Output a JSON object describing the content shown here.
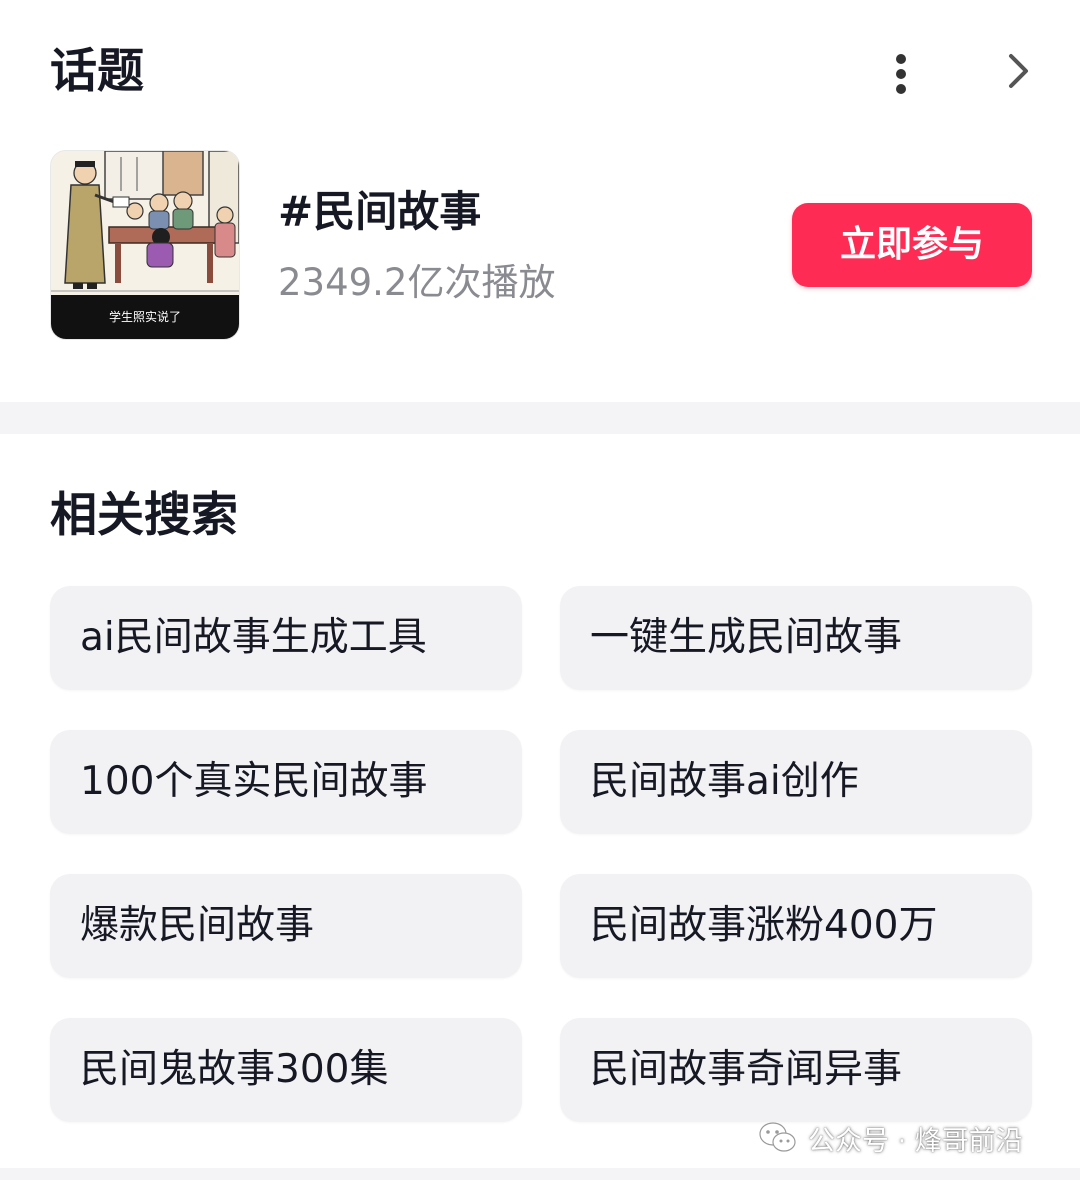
{
  "topic_section": {
    "title": "话题",
    "more_icon": "more-vertical-icon",
    "chevron_icon": "chevron-right-icon"
  },
  "topic": {
    "thumbnail_caption": "学生照实说了",
    "name": "#民间故事",
    "plays": "2349.2亿次播放",
    "join_label": "立即参与",
    "join_color": "#fe2c55"
  },
  "related": {
    "title": "相关搜索",
    "items": [
      {
        "label": "ai民间故事生成工具"
      },
      {
        "label": "一键生成民间故事"
      },
      {
        "label": "100个真实民间故事"
      },
      {
        "label": "民间故事ai创作"
      },
      {
        "label": "爆款民间故事"
      },
      {
        "label": "民间故事涨粉400万"
      },
      {
        "label": "民间鬼故事300集"
      },
      {
        "label": "民间故事奇闻异事"
      }
    ]
  },
  "watermark": {
    "text": "公众号 · 烽哥前沿",
    "icon": "wechat-icon"
  }
}
